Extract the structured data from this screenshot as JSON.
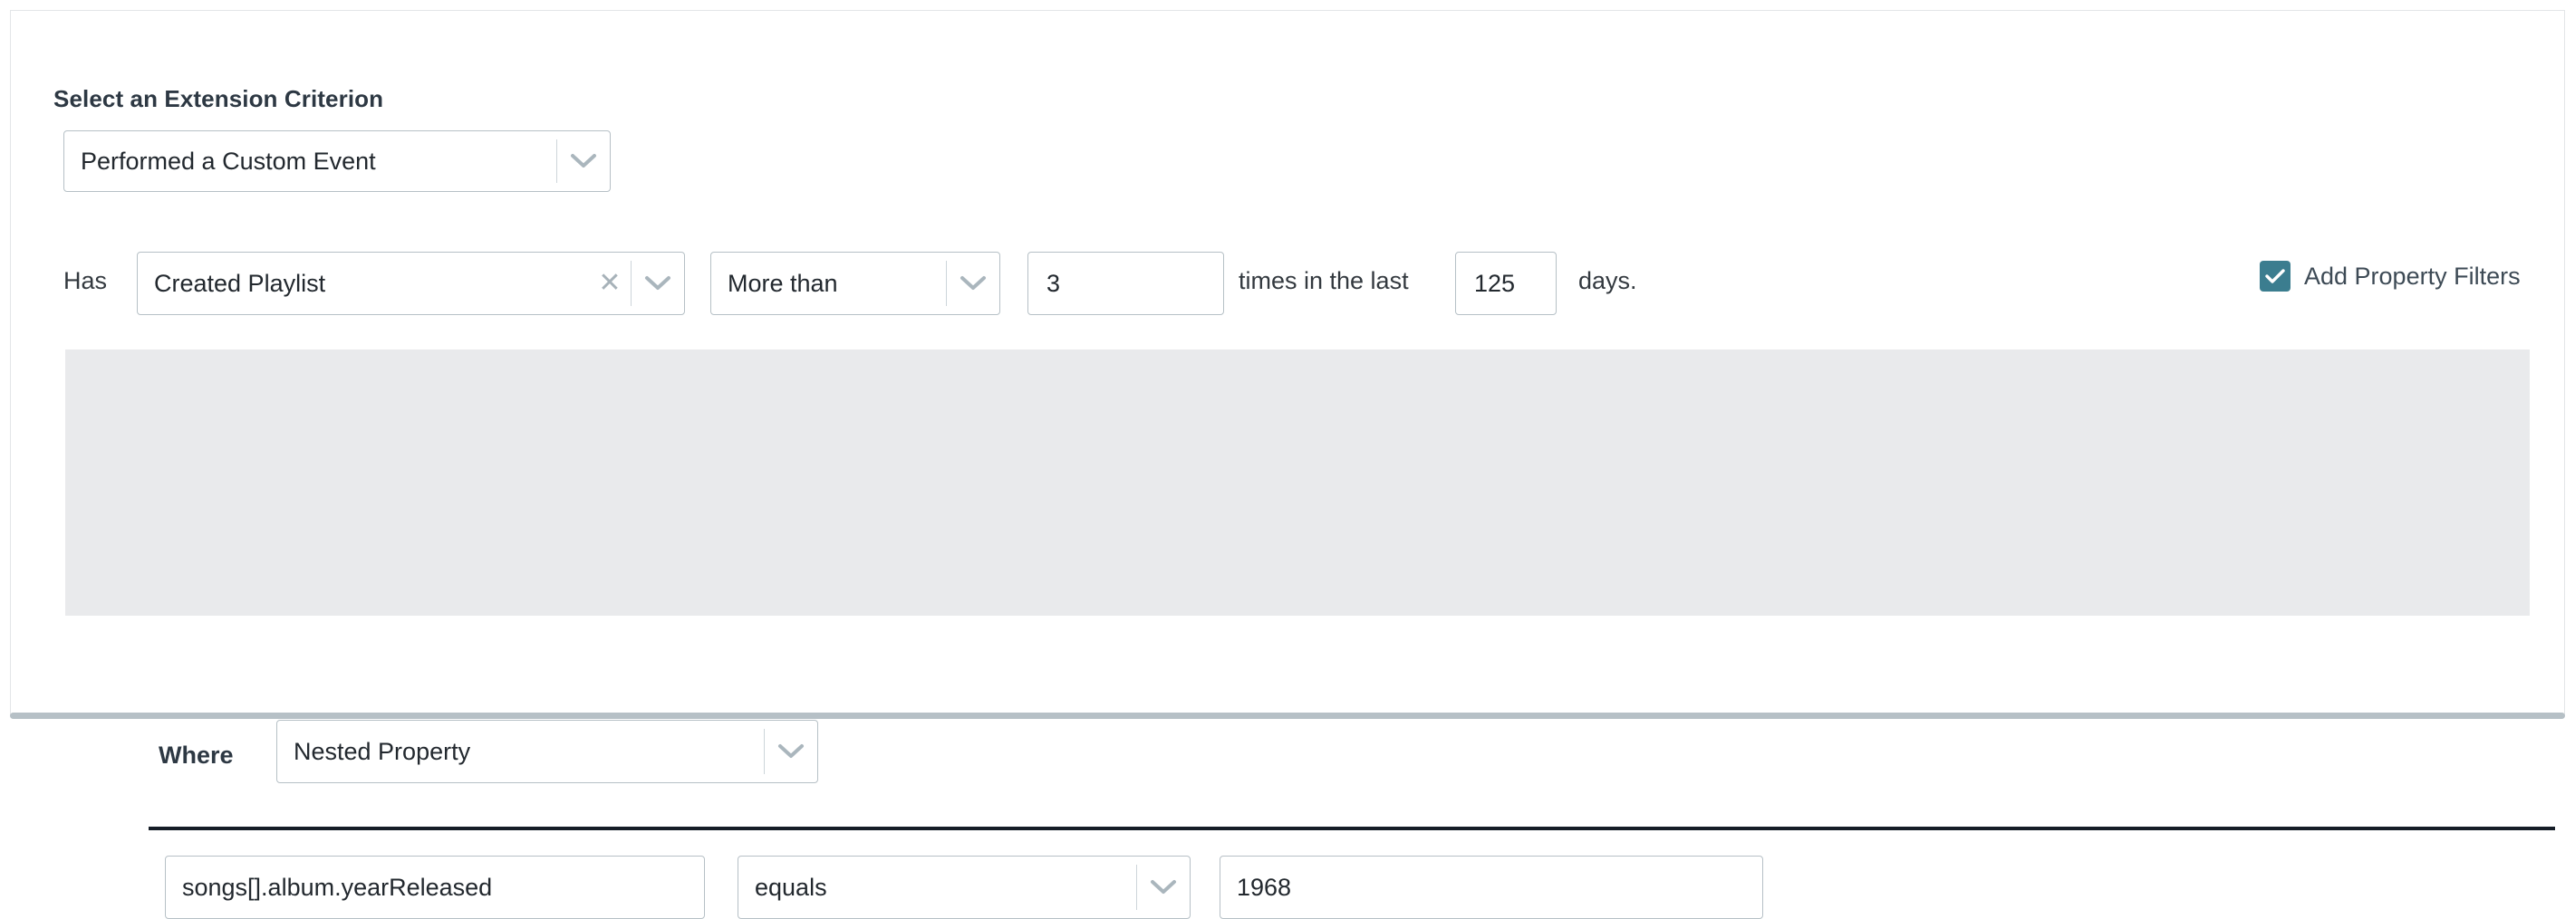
{
  "section": {
    "label": "Select an Extension Criterion"
  },
  "criterion": {
    "value": "Performed a Custom Event",
    "chevron_icon": "chevron-down-icon"
  },
  "condition_row": {
    "has_label": "Has",
    "event": {
      "value": "Created Playlist",
      "clear_icon": "close-icon",
      "chevron_icon": "chevron-down-icon"
    },
    "comparator": {
      "value": "More than",
      "chevron_icon": "chevron-down-icon"
    },
    "count": {
      "value": "3",
      "placeholder": ""
    },
    "times_text": "times in the last",
    "days": {
      "value": "125",
      "placeholder": ""
    },
    "days_text": "days."
  },
  "add_property_filters": {
    "label": "Add Property Filters",
    "checked": true,
    "check_icon": "checkmark-icon",
    "accent_color": "#3b7d8f"
  },
  "property_filter_panel": {
    "where_label": "Where",
    "nested": {
      "value": "Nested Property",
      "chevron_icon": "chevron-down-icon"
    },
    "property": {
      "value": "songs[].album.yearReleased",
      "placeholder": ""
    },
    "operator": {
      "value": "equals",
      "chevron_icon": "chevron-down-icon"
    },
    "filter_value": {
      "value": "1968",
      "placeholder": ""
    },
    "background_color": "#e9eaec"
  }
}
